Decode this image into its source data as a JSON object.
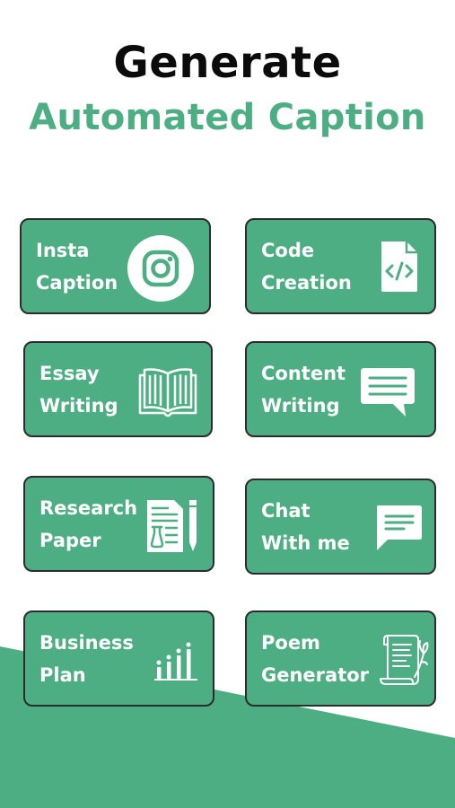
{
  "header": {
    "line1": "Generate",
    "line2": "Automated Caption"
  },
  "colors": {
    "accent": "#4cae82",
    "text_dark": "#0b0b0b",
    "card_border": "#2c2c2c",
    "background": "#ffffff"
  },
  "cards": [
    {
      "line1": "Insta",
      "line2": "Caption",
      "icon": "instagram-icon"
    },
    {
      "line1": "Code",
      "line2": "Creation",
      "icon": "code-file-icon"
    },
    {
      "line1": "Essay",
      "line2": "Writing",
      "icon": "open-book-icon"
    },
    {
      "line1": "Content",
      "line2": "Writing",
      "icon": "speech-bubble-icon"
    },
    {
      "line1": "Research",
      "line2": "Paper",
      "icon": "research-paper-icon"
    },
    {
      "line1": "Chat",
      "line2": "With me",
      "icon": "chat-message-icon"
    },
    {
      "line1": "Business",
      "line2": "Plan",
      "icon": "bar-chart-icon"
    },
    {
      "line1": "Poem",
      "line2": "Generator",
      "icon": "poem-scroll-icon"
    }
  ]
}
